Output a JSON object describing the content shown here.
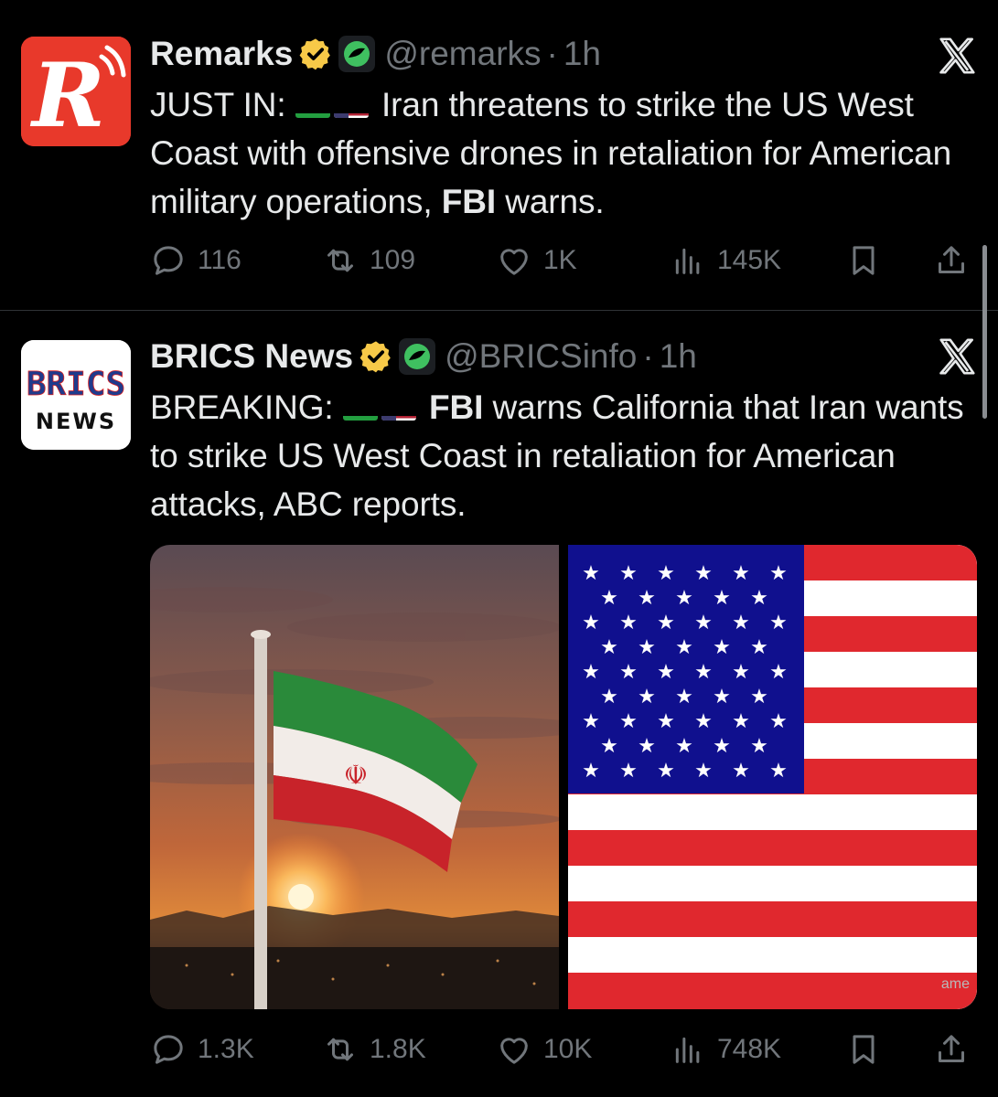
{
  "tweets": [
    {
      "name": "Remarks",
      "handle": "@remarks",
      "dot": "·",
      "time": "1h",
      "text_prefix": "JUST IN:",
      "text_a": "Iran threatens to strike the US West Coast with offensive drones in retaliation for American military operations,",
      "text_bold": "FBI",
      "text_b": "warns.",
      "replies": "116",
      "reposts": "109",
      "likes": "1K",
      "views": "145K",
      "avatar_letter": "R"
    },
    {
      "name": "BRICS News",
      "handle": "@BRICSinfo",
      "dot": "·",
      "time": "1h",
      "text_prefix": "BREAKING:",
      "text_bold": "FBI",
      "text_a": "warns California that Iran wants to strike US West Coast in retaliation for American attacks, ABC reports.",
      "replies": "1.3K",
      "reposts": "1.8K",
      "likes": "10K",
      "views": "748K",
      "avatar_top": "BRICS",
      "avatar_bottom": "NEWS",
      "media_watermark": "ame"
    }
  ],
  "icons": [
    "verified-badge-icon",
    "affiliate-badge-icon",
    "x-logo-icon",
    "reply-icon",
    "repost-icon",
    "like-icon",
    "views-icon",
    "bookmark-icon",
    "share-icon"
  ],
  "colors": {
    "background": "#000000",
    "text": "#e7e9ea",
    "muted": "#71767b",
    "remarks_red": "#e8392b",
    "gold_badge": "#f7c948"
  }
}
